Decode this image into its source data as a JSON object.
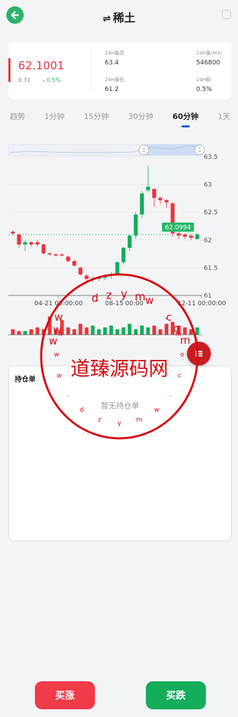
{
  "header": {
    "title": "稀土",
    "swap_glyph": "⇌"
  },
  "quote": {
    "price": "62.1001",
    "change": "0.31",
    "change_pct": "0.5%",
    "stats": [
      {
        "label": "24H最高",
        "value": "63.4"
      },
      {
        "label": "24H量(MX)",
        "value": "546800"
      },
      {
        "label": "24H最低",
        "value": "61.2"
      },
      {
        "label": "24H额",
        "value": "0.5%"
      }
    ]
  },
  "tabs": [
    {
      "label": "趋势"
    },
    {
      "label": "1分钟"
    },
    {
      "label": "15分钟"
    },
    {
      "label": "30分钟"
    },
    {
      "label": "60分钟",
      "active": true
    },
    {
      "label": "1天"
    }
  ],
  "chart_data": {
    "type": "candlestick",
    "y_ticks": [
      "63.5",
      "63",
      "62.5",
      "62",
      "61.5",
      "61"
    ],
    "x_ticks": [
      "04-21 00:00:00",
      "08-15 00:00",
      "12-11 00:00:00"
    ],
    "last_price_label": "62.0994",
    "last_price": 62.0994,
    "ylim": [
      61,
      63.5
    ],
    "candles": [
      {
        "o": 62.15,
        "c": 62.12,
        "h": 62.18,
        "l": 62.08
      },
      {
        "o": 62.1,
        "c": 61.92,
        "h": 62.12,
        "l": 61.86
      },
      {
        "o": 61.92,
        "c": 61.96,
        "h": 62.0,
        "l": 61.8
      },
      {
        "o": 61.96,
        "c": 61.92,
        "h": 61.98,
        "l": 61.88
      },
      {
        "o": 61.96,
        "c": 61.92,
        "h": 62.0,
        "l": 61.88
      },
      {
        "o": 61.92,
        "c": 61.76,
        "h": 61.94,
        "l": 61.74
      },
      {
        "o": 61.76,
        "c": 61.74,
        "h": 61.78,
        "l": 61.72
      },
      {
        "o": 61.74,
        "c": 61.72,
        "h": 61.76,
        "l": 61.7
      },
      {
        "o": 61.74,
        "c": 61.72,
        "h": 61.76,
        "l": 61.7
      },
      {
        "o": 61.7,
        "c": 61.62,
        "h": 61.72,
        "l": 61.6
      },
      {
        "o": 61.62,
        "c": 61.54,
        "h": 61.64,
        "l": 61.52
      },
      {
        "o": 61.5,
        "c": 61.38,
        "h": 61.52,
        "l": 61.36
      },
      {
        "o": 61.36,
        "c": 61.3,
        "h": 61.38,
        "l": 61.26
      },
      {
        "o": 61.29,
        "c": 61.31,
        "h": 61.34,
        "l": 61.24
      },
      {
        "o": 61.3,
        "c": 61.32,
        "h": 61.34,
        "l": 61.26
      },
      {
        "o": 61.32,
        "c": 61.36,
        "h": 61.38,
        "l": 61.28
      },
      {
        "o": 61.36,
        "c": 61.38,
        "h": 61.42,
        "l": 61.3
      },
      {
        "o": 61.38,
        "c": 61.6,
        "h": 61.62,
        "l": 61.36
      },
      {
        "o": 61.6,
        "c": 61.86,
        "h": 61.88,
        "l": 61.56
      },
      {
        "o": 61.86,
        "c": 62.08,
        "h": 62.1,
        "l": 61.8
      },
      {
        "o": 62.08,
        "c": 62.46,
        "h": 62.5,
        "l": 62.02
      },
      {
        "o": 62.46,
        "c": 62.84,
        "h": 62.88,
        "l": 62.4
      },
      {
        "o": 62.9,
        "c": 62.96,
        "h": 63.34,
        "l": 62.86
      },
      {
        "o": 62.92,
        "c": 62.76,
        "h": 62.94,
        "l": 62.6
      },
      {
        "o": 62.76,
        "c": 62.72,
        "h": 62.78,
        "l": 62.64
      },
      {
        "o": 62.72,
        "c": 62.68,
        "h": 62.74,
        "l": 62.58
      },
      {
        "o": 62.66,
        "c": 62.12,
        "h": 62.68,
        "l": 62.06
      },
      {
        "o": 62.12,
        "c": 62.08,
        "h": 62.14,
        "l": 62.02
      },
      {
        "o": 62.1,
        "c": 62.06,
        "h": 62.12,
        "l": 62.02
      },
      {
        "o": 62.08,
        "c": 62.04,
        "h": 62.1,
        "l": 62.0
      },
      {
        "o": 62.02,
        "c": 62.1,
        "h": 62.12,
        "l": 62.0
      }
    ],
    "volumes": [
      0.3,
      0.2,
      0.2,
      0.3,
      0.4,
      0.3,
      1.0,
      0.3,
      0.8,
      0.4,
      0.3,
      0.6,
      0.4,
      0.5,
      0.3,
      0.4,
      0.5,
      0.3,
      0.4,
      0.6,
      0.3,
      0.5,
      0.4,
      0.5,
      0.3,
      0.6,
      0.7,
      0.5,
      0.4,
      0.3,
      0.4
    ]
  },
  "colors": {
    "up": "#13ad5b",
    "down": "#e8363d",
    "accent": "#2a5bd7",
    "stamp": "#d40d12"
  },
  "positions": {
    "title": "持仓单",
    "empty_text": "暂无持仓单"
  },
  "stamp": {
    "center_text": "道臻源码网",
    "top_arc": "dzym",
    "url_chars": "w w w . d z y m w . c o m"
  },
  "actions": {
    "buy_up": "买涨",
    "buy_down": "买跌"
  }
}
